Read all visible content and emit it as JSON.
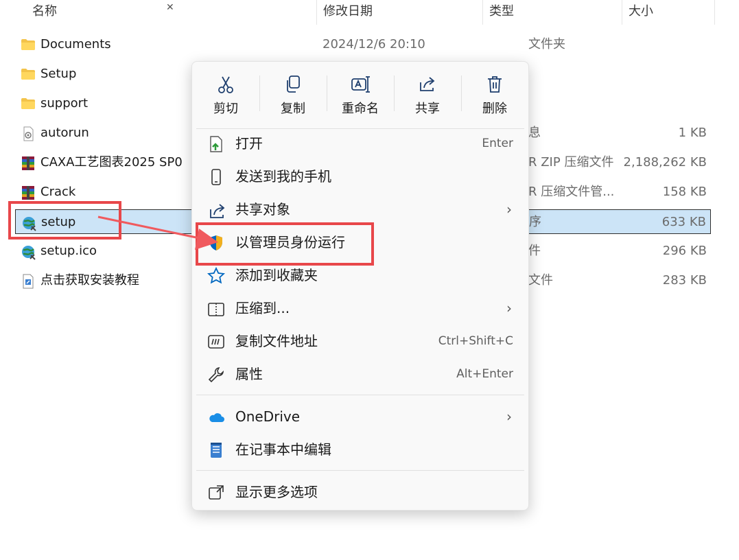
{
  "header": {
    "col_name": "名称",
    "col_date": "修改日期",
    "col_type": "类型",
    "col_size": "大小"
  },
  "files": [
    {
      "name": "Documents",
      "date": "2024/12/6 20:10",
      "type": "文件夹",
      "size": "",
      "icon": "folder-icon"
    },
    {
      "name": "Setup",
      "date": "",
      "type": "",
      "size": "",
      "icon": "folder-icon"
    },
    {
      "name": "support",
      "date": "",
      "type": "",
      "size": "",
      "icon": "folder-icon"
    },
    {
      "name": "autorun",
      "date": "",
      "type": "息",
      "size": "1 KB",
      "icon": "settings-file-icon"
    },
    {
      "name": "CAXA工艺图表2025 SP0",
      "date": "",
      "type": "R ZIP 压缩文件",
      "size": "2,188,262 KB",
      "icon": "winrar-icon"
    },
    {
      "name": "Crack",
      "date": "",
      "type": "R 压缩文件管...",
      "size": "158 KB",
      "icon": "winrar-icon"
    },
    {
      "name": "setup",
      "date": "",
      "type": "序",
      "size": "633 KB",
      "icon": "setup-globe-icon",
      "selected": true
    },
    {
      "name": "setup.ico",
      "date": "",
      "type": "件",
      "size": "296 KB",
      "icon": "setup-globe-icon"
    },
    {
      "name": "点击获取安装教程",
      "date": "",
      "type": "文件",
      "size": "283 KB",
      "icon": "shortcut-icon"
    }
  ],
  "menu": {
    "toolbar": [
      {
        "label": "剪切",
        "icon": "scissors-icon"
      },
      {
        "label": "复制",
        "icon": "copy-icon"
      },
      {
        "label": "重命名",
        "icon": "rename-icon"
      },
      {
        "label": "共享",
        "icon": "share-icon"
      },
      {
        "label": "删除",
        "icon": "trash-icon"
      }
    ],
    "items": [
      {
        "label": "打开",
        "shortcut": "Enter",
        "icon": "open-icon"
      },
      {
        "label": "发送到我的手机",
        "shortcut": "",
        "icon": "phone-icon"
      },
      {
        "label": "共享对象",
        "shortcut": "",
        "icon": "share-icon",
        "submenu": true
      },
      {
        "label": "以管理员身份运行",
        "shortcut": "",
        "icon": "shield-icon"
      },
      {
        "label": "添加到收藏夹",
        "shortcut": "",
        "icon": "star-icon"
      },
      {
        "label": "压缩到...",
        "shortcut": "",
        "icon": "zip-icon",
        "submenu": true
      },
      {
        "label": "复制文件地址",
        "shortcut": "Ctrl+Shift+C",
        "icon": "copy-path-icon"
      },
      {
        "label": "属性",
        "shortcut": "Alt+Enter",
        "icon": "wrench-icon"
      }
    ],
    "items2": [
      {
        "label": "OneDrive",
        "icon": "onedrive-icon",
        "submenu": true
      },
      {
        "label": "在记事本中编辑",
        "icon": "notepad-icon"
      }
    ],
    "more": {
      "label": "显示更多选项",
      "icon": "more-options-icon"
    },
    "chevron": "›"
  },
  "colors": {
    "annotation": "#e8474a",
    "selection": "#cce4f7",
    "accent": "#0067c0"
  }
}
